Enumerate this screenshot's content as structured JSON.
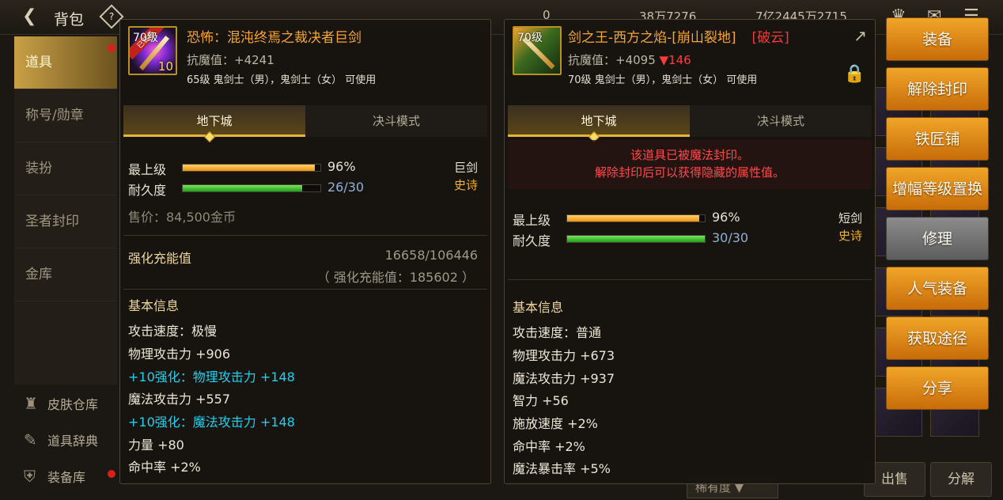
{
  "header": {
    "title": "背包",
    "help": "?",
    "currency": [
      "0",
      "38万7276",
      "7亿2445万2715"
    ]
  },
  "sidebar": {
    "items": [
      {
        "label": "道具"
      },
      {
        "label": "称号/勋章"
      },
      {
        "label": "装扮"
      },
      {
        "label": "圣者封印"
      },
      {
        "label": "金库"
      }
    ],
    "bottom": [
      {
        "label": "皮肤仓库",
        "icon": "warehouse-icon"
      },
      {
        "label": "道具辞典",
        "icon": "book-icon"
      },
      {
        "label": "装备库",
        "icon": "armor-icon"
      }
    ]
  },
  "bottom_bar": {
    "rarity": "稀有度",
    "sell": "出售",
    "disassemble": "分解"
  },
  "panel_left": {
    "icon_level": "70级",
    "icon_plus": "10",
    "icon_tag": "已装备",
    "name": "恐怖：混沌终焉之裁决者巨剑",
    "resist": "抗魔值：+4241",
    "usable": "65级 鬼剑士（男），鬼剑士（女） 可使用",
    "tabs": [
      "地下城",
      "决斗模式"
    ],
    "max_level_label": "最上级",
    "max_level_value": "96%",
    "max_level_pct": 96,
    "durability_label": "耐久度",
    "durability_value": "26/30",
    "durability_pct": 86.7,
    "type_main": "巨剑",
    "type_sub": "史诗",
    "price": "售价：84,500金币",
    "charge_label": "强化充能值",
    "charge_value": "16658/106446",
    "charge_sub": "（ 强化充能值：185602 ）",
    "basic_info": "基本信息",
    "stats": [
      {
        "text": "攻击速度：极慢",
        "cyan": false
      },
      {
        "text": "物理攻击力 +906",
        "cyan": false
      },
      {
        "text": "+10强化：物理攻击力 +148",
        "cyan": true
      },
      {
        "text": "魔法攻击力 +557",
        "cyan": false
      },
      {
        "text": "+10强化：魔法攻击力 +148",
        "cyan": true
      },
      {
        "text": "力量 +80",
        "cyan": false
      },
      {
        "text": "命中率 +2%",
        "cyan": false
      }
    ]
  },
  "panel_right": {
    "icon_level": "70级",
    "name": "剑之王-西方之焰-[崩山裂地]",
    "name_tag": "[破云]",
    "resist": "抗魔值：+4095 ",
    "resist_diff": "▼146",
    "usable": "70级 鬼剑士（男），鬼剑士（女） 可使用",
    "tabs": [
      "地下城",
      "决斗模式"
    ],
    "seal_line1": "该道具已被魔法封印。",
    "seal_line2": "解除封印后可以获得隐藏的属性值。",
    "max_level_label": "最上级",
    "max_level_value": "96%",
    "max_level_pct": 96,
    "durability_label": "耐久度",
    "durability_value": "30/30",
    "durability_pct": 100,
    "type_main": "短剑",
    "type_sub": "史诗",
    "basic_info": "基本信息",
    "stats": [
      {
        "text": "攻击速度：普通"
      },
      {
        "text": "物理攻击力 +673"
      },
      {
        "text": "魔法攻击力 +937"
      },
      {
        "text": "智力 +56"
      },
      {
        "text": "施放速度 +2%"
      },
      {
        "text": "命中率 +2%"
      },
      {
        "text": "魔法暴击率 +5%"
      }
    ]
  },
  "actions": [
    {
      "label": "装备",
      "style": "orange"
    },
    {
      "label": "解除封印",
      "style": "orange"
    },
    {
      "label": "铁匠铺",
      "style": "orange"
    },
    {
      "label": "增幅等级置换",
      "style": "orange"
    },
    {
      "label": "修理",
      "style": "grey"
    },
    {
      "label": "人气装备",
      "style": "orange"
    },
    {
      "label": "获取途径",
      "style": "orange"
    },
    {
      "label": "分享",
      "style": "orange"
    }
  ]
}
